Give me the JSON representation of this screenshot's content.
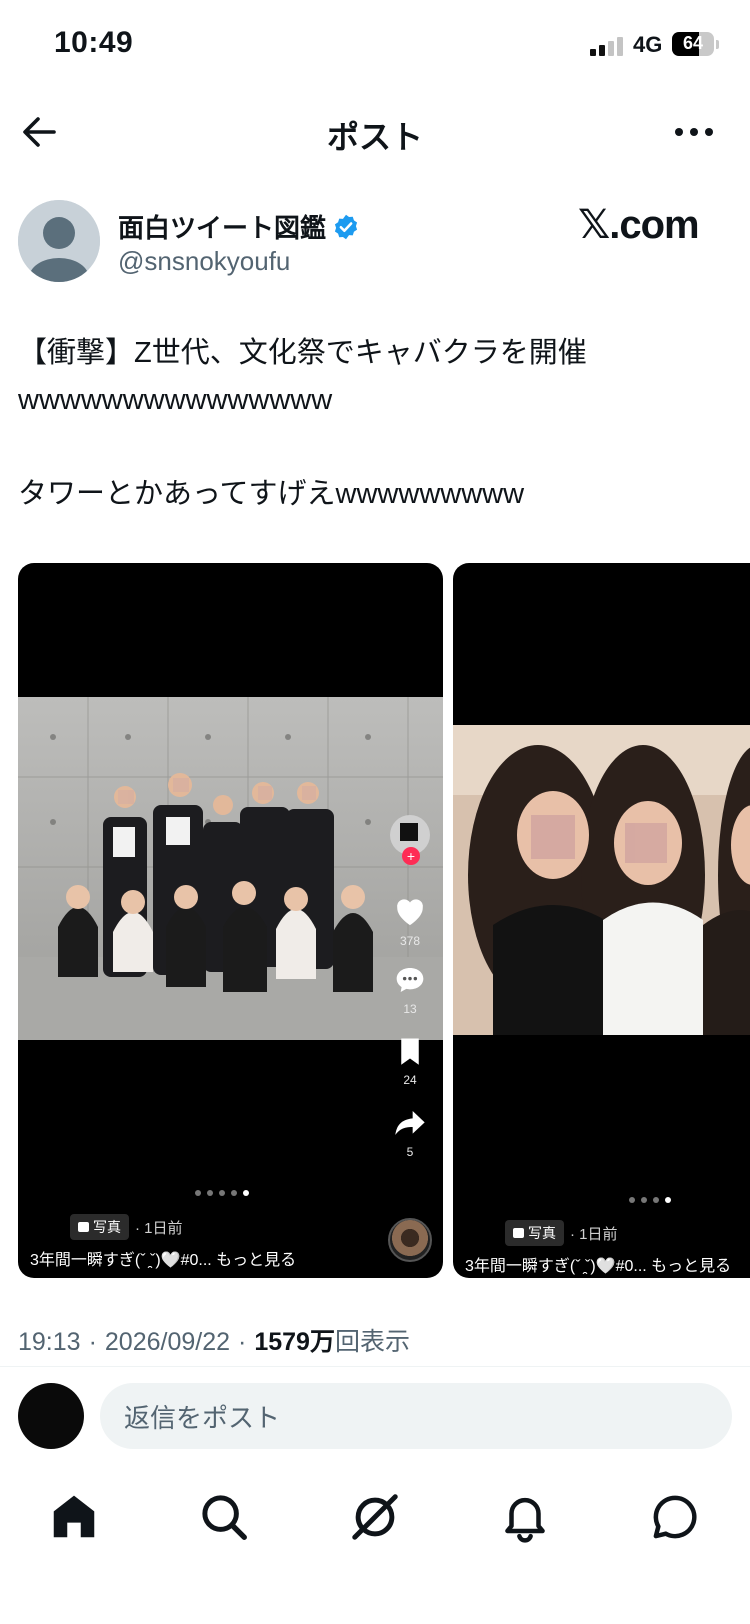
{
  "status_bar": {
    "time": "10:49",
    "network": "4G",
    "battery": "64",
    "battery_level": 0.64
  },
  "header": {
    "title": "ポスト"
  },
  "author": {
    "display_name": "面白ツイート図鑑",
    "handle": "@snsnokyoufu"
  },
  "watermark": "𝕏.com",
  "post": {
    "text": "【衝撃】Z世代、文化祭でキャバクラを開催\nwwwwwwwwwwwwwww\n\nタワーとかあってすげえwwwwwwwww"
  },
  "media": [
    {
      "likes": "378",
      "comments": "13",
      "saves": "24",
      "shares": "5",
      "chip": "写真",
      "time_ago": "· 1日前",
      "caption": "3年間一瞬すぎ(ˇ ̯ˇ)🤍#0... もっと見る",
      "pages": 5,
      "active_page": 5
    },
    {
      "chip": "写真",
      "time_ago": "· 1日前",
      "caption": "3年間一瞬すぎ(ˇ ̯ˇ)🤍#0... もっと見る",
      "pages": 4,
      "active_page": 4
    }
  ],
  "meta": {
    "time": "19:13",
    "date": "2026/09/22",
    "views": "1579万",
    "views_label": "回表示",
    "separator": "·"
  },
  "reply": {
    "placeholder": "返信をポスト"
  },
  "nav": [
    "home-icon",
    "search-icon",
    "grok-icon",
    "notifications-icon",
    "messages-icon"
  ],
  "colors": {
    "verified": "#1d9bf0",
    "text": "#0f1419",
    "secondary": "#536471",
    "input_bg": "#eff3f4"
  }
}
